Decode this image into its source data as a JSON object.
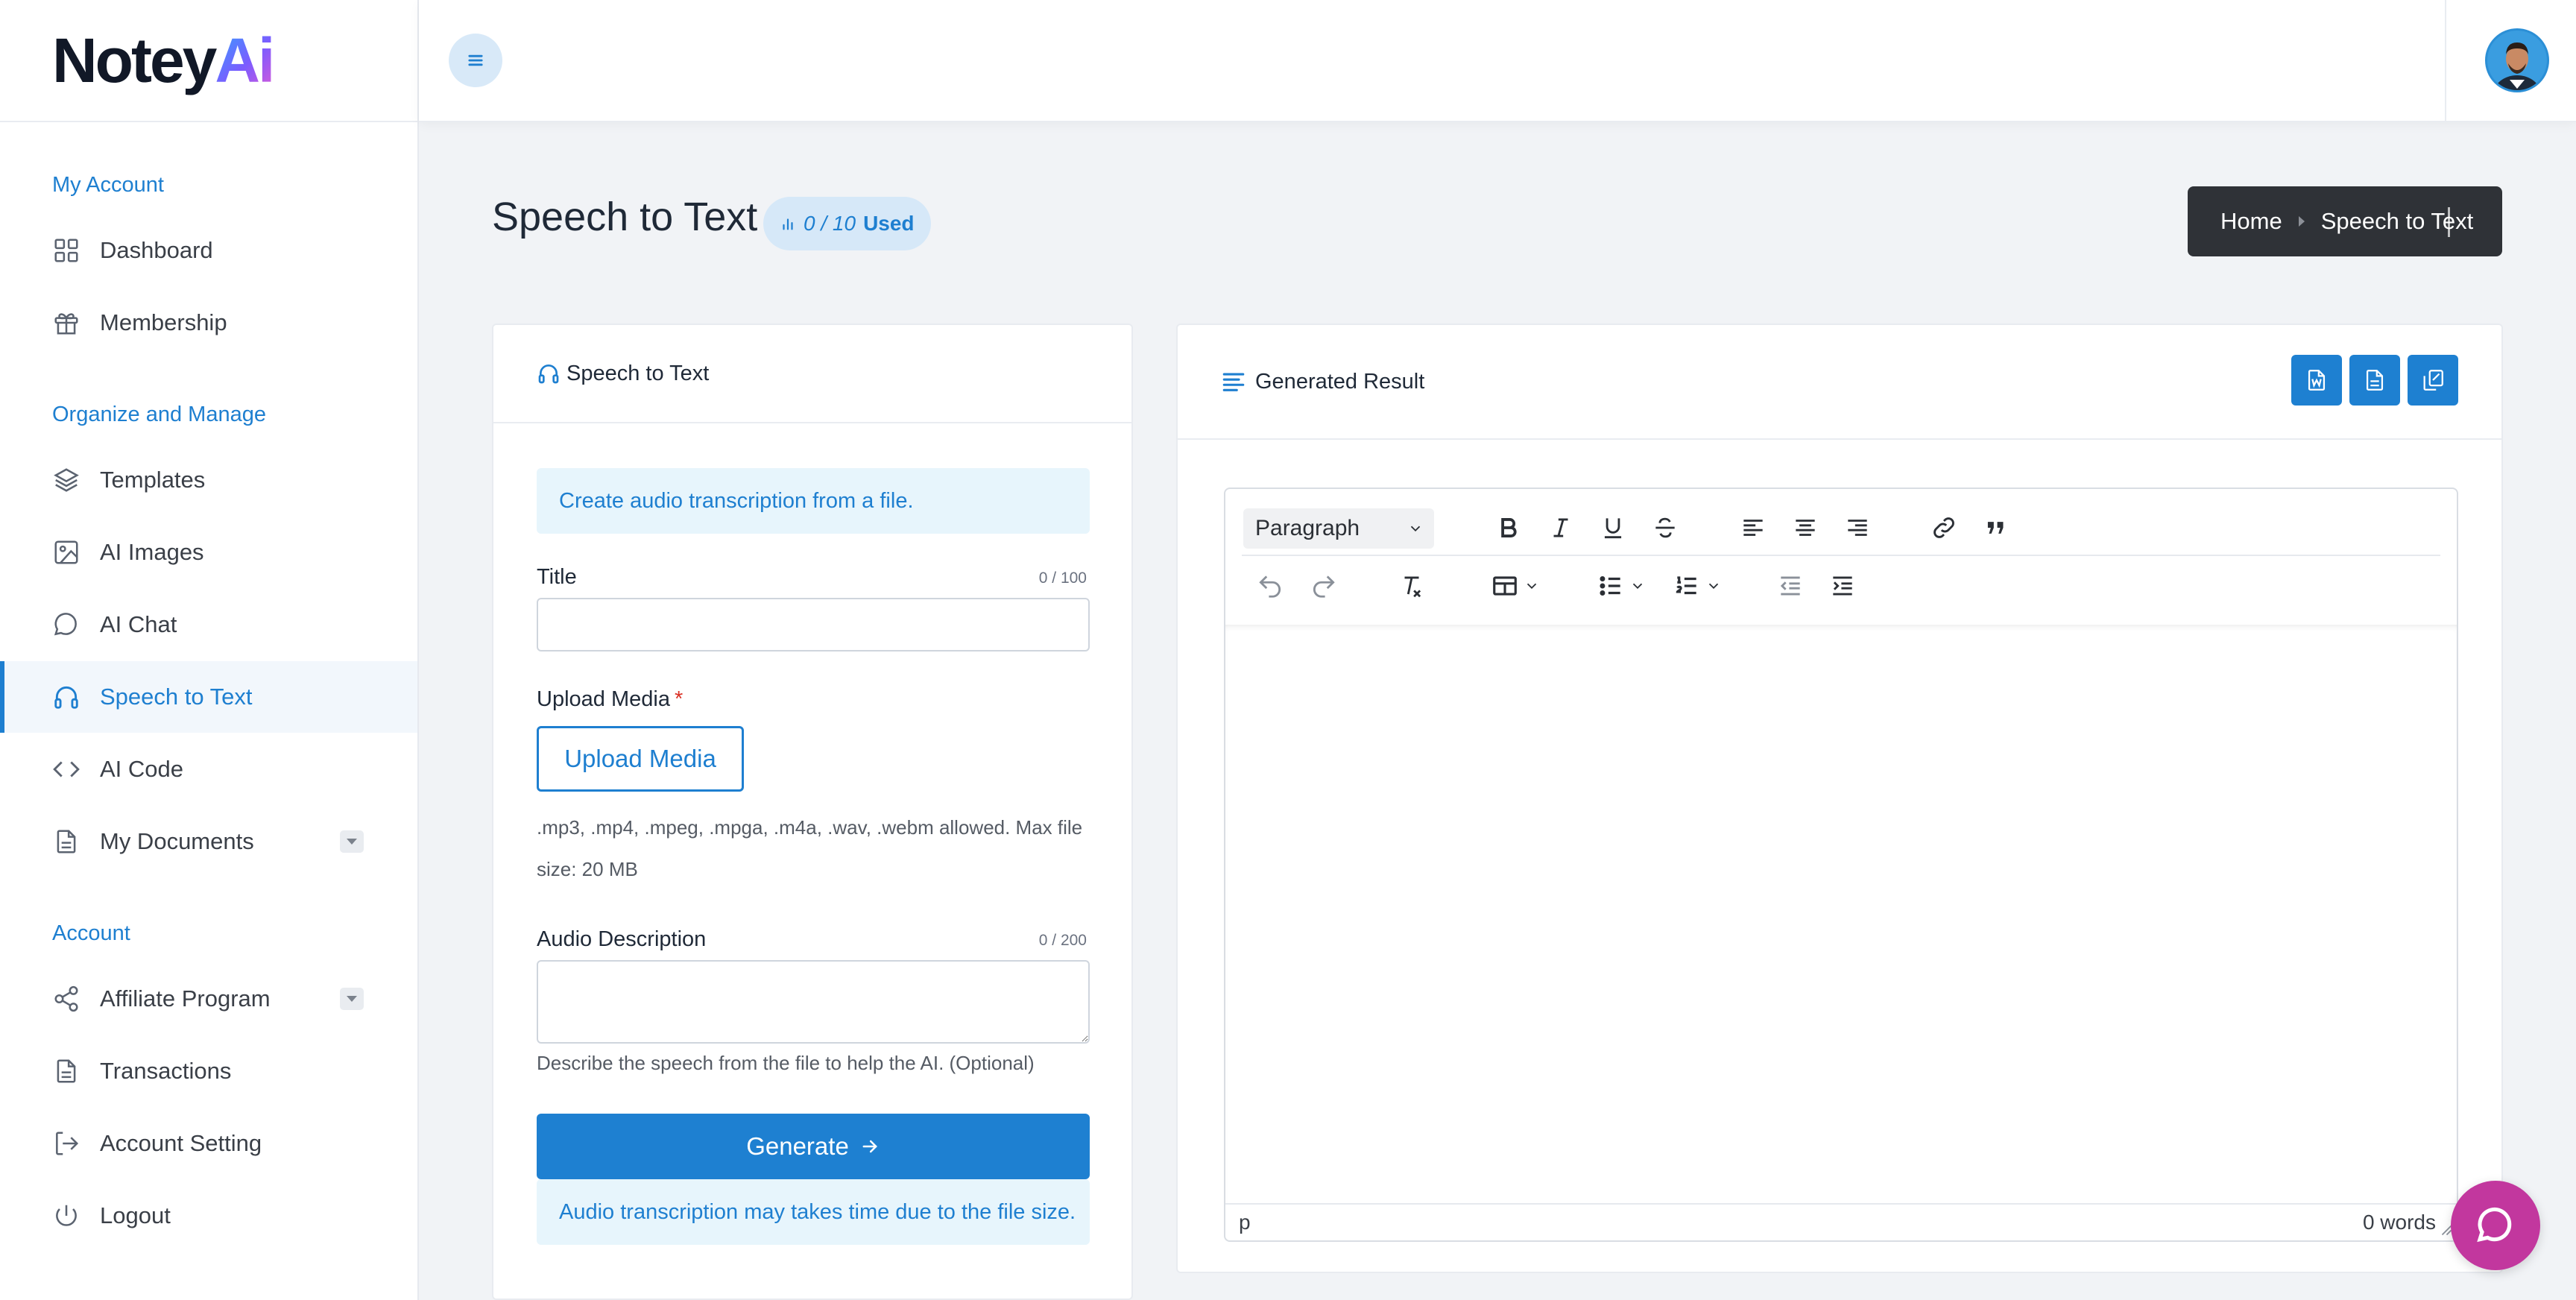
{
  "brand": {
    "logo_main": "Notey",
    "logo_ai": "Ai"
  },
  "sidebar": {
    "sections": [
      {
        "title": "My Account",
        "items": [
          {
            "label": "Dashboard",
            "icon": "grid-icon"
          },
          {
            "label": "Membership",
            "icon": "gift-icon"
          }
        ]
      },
      {
        "title": "Organize and Manage",
        "items": [
          {
            "label": "Templates",
            "icon": "layers-icon"
          },
          {
            "label": "AI Images",
            "icon": "image-icon"
          },
          {
            "label": "AI Chat",
            "icon": "chat-icon"
          },
          {
            "label": "Speech to Text",
            "icon": "headphones-icon",
            "active": true
          },
          {
            "label": "AI Code",
            "icon": "code-icon"
          },
          {
            "label": "My Documents",
            "icon": "document-icon",
            "has_submenu": true
          }
        ]
      },
      {
        "title": "Account",
        "items": [
          {
            "label": "Affiliate Program",
            "icon": "share-icon",
            "has_submenu": true
          },
          {
            "label": "Transactions",
            "icon": "receipt-icon"
          },
          {
            "label": "Account Setting",
            "icon": "logout-arrow-icon"
          },
          {
            "label": "Logout",
            "icon": "power-icon"
          }
        ]
      }
    ]
  },
  "header": {
    "page_title": "Speech to Text",
    "usage_count": "0 / 10",
    "usage_label": "Used",
    "breadcrumb": {
      "home": "Home",
      "current": "Speech to Text"
    }
  },
  "form_card": {
    "title": "Speech to Text",
    "info": "Create audio transcription from a file.",
    "title_field": {
      "label": "Title",
      "counter": "0 / 100",
      "value": ""
    },
    "upload": {
      "label": "Upload Media",
      "required_mark": "*",
      "button": "Upload Media",
      "help_line1": ".mp3, .mp4, .mpeg, .mpga, .m4a, .wav, .webm allowed. Max file",
      "help_line2": "size: 20 MB"
    },
    "description_field": {
      "label": "Audio Description",
      "counter": "0 / 200",
      "value": "",
      "help": "Describe the speech from the file to help the AI. (Optional)"
    },
    "generate_button": "Generate",
    "notice": "Audio transcription may takes time due to the file size."
  },
  "result_card": {
    "title": "Generated Result",
    "actions": [
      "word-export-icon",
      "document-export-icon",
      "copy-icon"
    ],
    "editor": {
      "block_format": "Paragraph",
      "status_path": "p",
      "word_count": "0 words"
    }
  },
  "colors": {
    "accent": "#1e7fd0",
    "breadcrumb_bg": "#2f3237",
    "chat_bubble": "#c2379e",
    "info_bg": "#e7f5fc"
  }
}
